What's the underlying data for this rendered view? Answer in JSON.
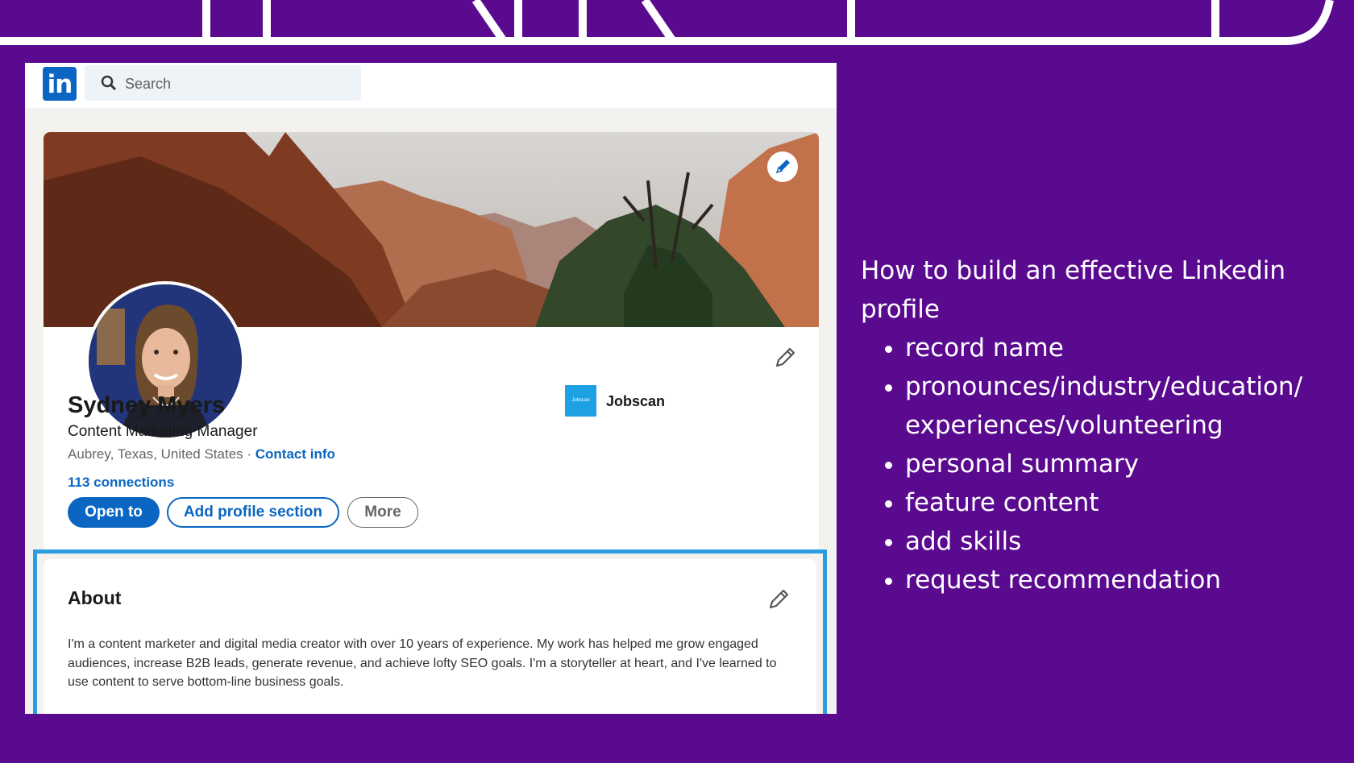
{
  "app": {
    "search": {
      "placeholder": "Search"
    },
    "profile": {
      "name": "Sydney Myers",
      "headline": "Content Marketing Manager",
      "location": "Aubrey, Texas, United States",
      "separator": " · ",
      "contact_label": "Contact info",
      "connections": "113 connections",
      "company": {
        "name": "Jobscan",
        "logo_text": "Jobscan"
      },
      "buttons": {
        "open_to": "Open to",
        "add_section": "Add profile section",
        "more": "More"
      }
    },
    "about": {
      "title": "About",
      "text": "I'm a content marketer and digital media creator with over 10 years of experience. My work has helped me grow engaged audiences, increase B2B leads, generate revenue, and achieve lofty SEO goals. I'm a storyteller at heart, and I've learned to use content to serve bottom-line business goals."
    }
  },
  "panel": {
    "title": "How to build an effective Linkedin profile",
    "items": [
      "record name",
      "pronounces/industry/education/ experiences/volunteering",
      "personal summary",
      "feature content",
      "add skills",
      "request recommendation"
    ]
  },
  "colors": {
    "background": "#5a0a8f",
    "linkedin_blue": "#0a66c2",
    "highlight_border": "#2c9ee0",
    "jobscan": "#1da1e3"
  },
  "icons": [
    "linkedin-logo",
    "search-icon",
    "pencil-icon",
    "company-logo"
  ]
}
